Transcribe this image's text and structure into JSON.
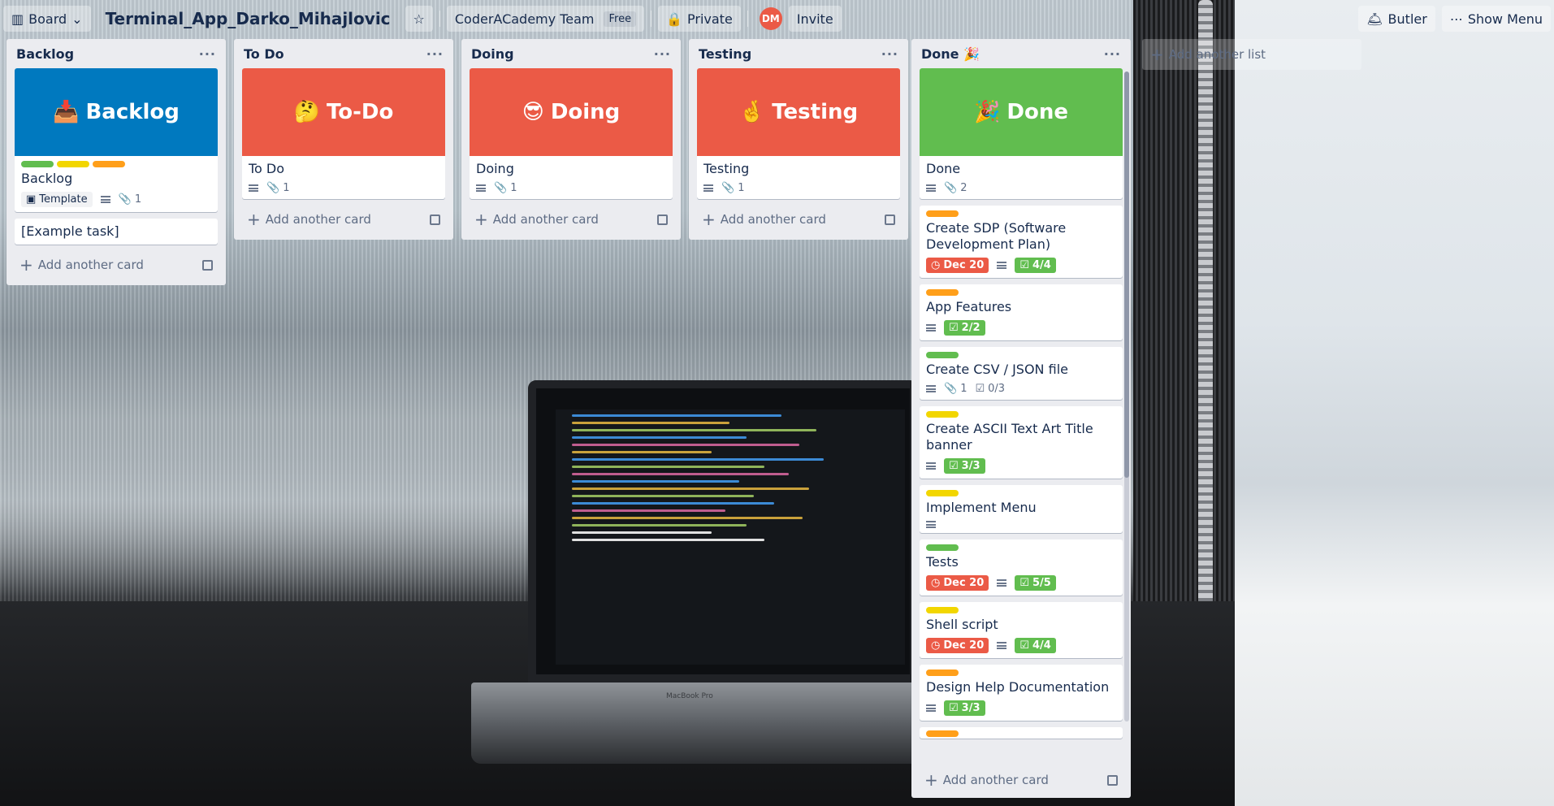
{
  "header": {
    "board_menu": "Board",
    "board_title": "Terminal_App_Darko_Mihajlovic",
    "team": "CoderACademy Team",
    "team_plan": "Free",
    "visibility": "Private",
    "avatar_initials": "DM",
    "invite": "Invite",
    "butler": "Butler",
    "show_menu": "Show Menu"
  },
  "add_card_label": "Add another card",
  "add_list_label": "Add another list",
  "lists": [
    {
      "title": "Backlog",
      "cover_text": "Backlog",
      "cover_emoji": "📥",
      "card_title": "Backlog",
      "template_label": "Template",
      "attachments": "1",
      "extra_card": "[Example task]"
    },
    {
      "title": "To Do",
      "cover_text": "To-Do",
      "cover_emoji": "🤔",
      "card_title": "To Do",
      "attachments": "1"
    },
    {
      "title": "Doing",
      "cover_text": "Doing",
      "cover_emoji": "😎",
      "card_title": "Doing",
      "attachments": "1"
    },
    {
      "title": "Testing",
      "cover_text": "Testing",
      "cover_emoji": "🤞",
      "card_title": "Testing",
      "attachments": "1"
    },
    {
      "title": "Done 🎉",
      "cover_text": "Done",
      "cover_emoji": "🎉",
      "card_title": "Done",
      "attachments": "2"
    }
  ],
  "done_cards": [
    {
      "title": "Create SDP (Software Development Plan)",
      "label": "#ff9f1a",
      "due": "Dec 20",
      "check": "4/4"
    },
    {
      "title": "App Features",
      "label": "#ff9f1a",
      "check": "2/2"
    },
    {
      "title": "Create CSV / JSON file",
      "label": "#61bd4f",
      "attachments": "1",
      "check_plain": "0/3"
    },
    {
      "title": "Create ASCII Text Art Title banner",
      "label": "#f2d600",
      "check": "3/3"
    },
    {
      "title": "Implement Menu",
      "label": "#f2d600"
    },
    {
      "title": "Tests",
      "label": "#61bd4f",
      "due": "Dec 20",
      "check": "5/5"
    },
    {
      "title": "Shell script",
      "label": "#f2d600",
      "due": "Dec 20",
      "check": "4/4"
    },
    {
      "title": "Design Help Documentation",
      "label": "#ff9f1a",
      "check": "3/3"
    }
  ],
  "colors": {
    "backlog_cover": "#0079bf",
    "red_cover": "#eb5a46",
    "green_cover": "#61bd4f",
    "label_green": "#61bd4f",
    "label_yellow": "#f2d600",
    "label_orange": "#ff9f1a"
  }
}
